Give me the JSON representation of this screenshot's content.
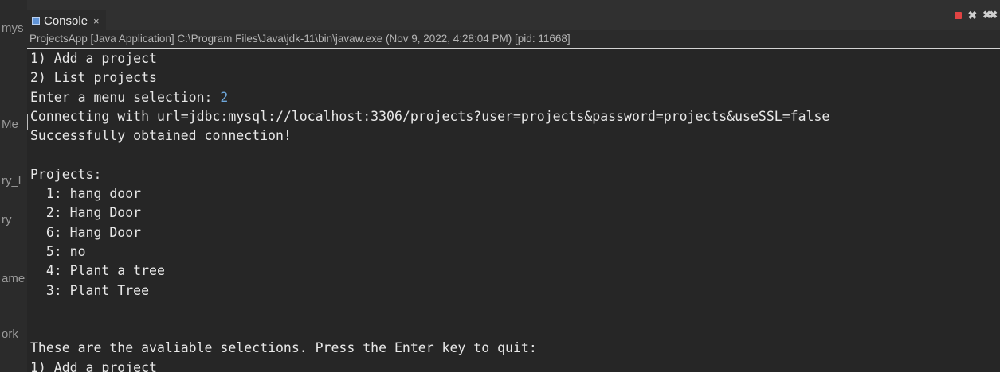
{
  "gutter": {
    "fragments": [
      "mys",
      "Me",
      "ry_l",
      "ry",
      "ame",
      "ork"
    ]
  },
  "tab": {
    "label": "Console",
    "close": "×"
  },
  "view_actions": {
    "terminate": "terminate-icon",
    "remove": "✖",
    "remove_all": "✖✖"
  },
  "launch_info": "ProjectsApp [Java Application] C:\\Program Files\\Java\\jdk-11\\bin\\javaw.exe  (Nov 9, 2022, 4:28:04 PM) [pid: 11668]",
  "console": {
    "menu_1": "1) Add a project",
    "menu_2": "2) List projects",
    "prompt": "Enter a menu selection: ",
    "prompt_input": "2",
    "connecting": "Connecting with url=jdbc:mysql://localhost:3306/projects?user=projects&password=projects&useSSL=false",
    "success": "Successfully obtained connection!",
    "blank_1": "",
    "projects_header": "Projects:",
    "projects": [
      "  1: hang door",
      "  2: Hang Door",
      "  6: Hang Door",
      "  5: no",
      "  4: Plant a tree",
      "  3: Plant Tree"
    ],
    "blank_2": "",
    "blank_3": "",
    "selections": "These are the avaliable selections. Press the Enter key to quit:",
    "menu_1_again": "1) Add a project"
  },
  "colors": {
    "background": "#262626",
    "text": "#e8e8e8",
    "input_echo": "#6fa8dc",
    "terminate": "#e04343"
  }
}
